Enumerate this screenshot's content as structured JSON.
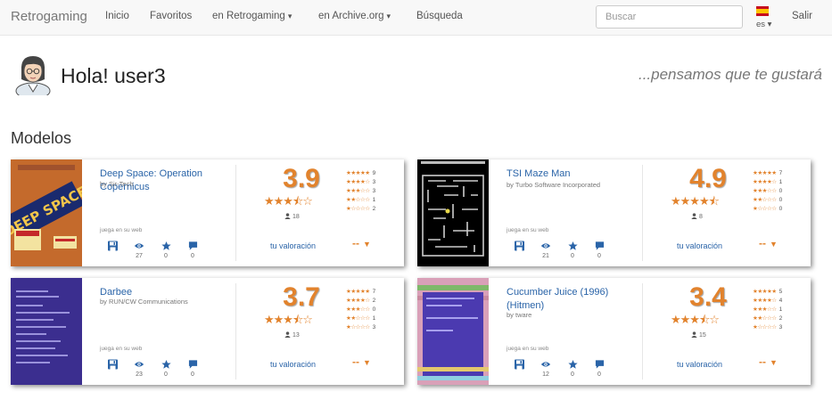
{
  "navbar": {
    "brand": "Retrogaming",
    "links": [
      "Inicio",
      "Favoritos",
      "en Retrogaming",
      "en Archive.org",
      "Búsqueda"
    ],
    "caret": "▾",
    "search_placeholder": "Buscar",
    "lang": "es ▾",
    "logout": "Salir"
  },
  "greeting": {
    "hello": "Hola! user3",
    "tagline": "...pensamos que te gustará"
  },
  "section": {
    "title": "Modelos"
  },
  "labels": {
    "play": "juega en su web",
    "your_rating": "tu valoración",
    "my_vote": "--"
  },
  "colors": {
    "accent": "#e2832d",
    "link": "#2a64a8"
  },
  "icons": [
    "disk-icon",
    "eye-icon",
    "star-icon",
    "comment-icon",
    "user-icon"
  ],
  "cards": [
    {
      "title": "Deep Space: Operation Copernicus",
      "author": "by Sir-Tech",
      "views": "27",
      "favs": "0",
      "comments": "0",
      "rating": "3.9",
      "stars": "★★★⯪☆",
      "votes": "18",
      "dist": [
        "9",
        "3",
        "3",
        "1",
        "2"
      ]
    },
    {
      "title": "TSI Maze Man",
      "author": "by Turbo Software Incorporated",
      "views": "21",
      "favs": "0",
      "comments": "0",
      "rating": "4.9",
      "stars": "★★★★⯪",
      "votes": "8",
      "dist": [
        "7",
        "1",
        "0",
        "0",
        "0"
      ]
    },
    {
      "title": "Darbee",
      "author": "by RUN/CW Communications",
      "views": "23",
      "favs": "0",
      "comments": "0",
      "rating": "3.7",
      "stars": "★★★⯪☆",
      "votes": "13",
      "dist": [
        "7",
        "2",
        "0",
        "1",
        "3"
      ]
    },
    {
      "title": "Cucumber Juice (1996) (Hitmen)",
      "author": "by tware",
      "views": "12",
      "favs": "0",
      "comments": "0",
      "rating": "3.4",
      "stars": "★★★⯪☆",
      "votes": "15",
      "dist": [
        "5",
        "4",
        "1",
        "2",
        "3"
      ]
    }
  ]
}
